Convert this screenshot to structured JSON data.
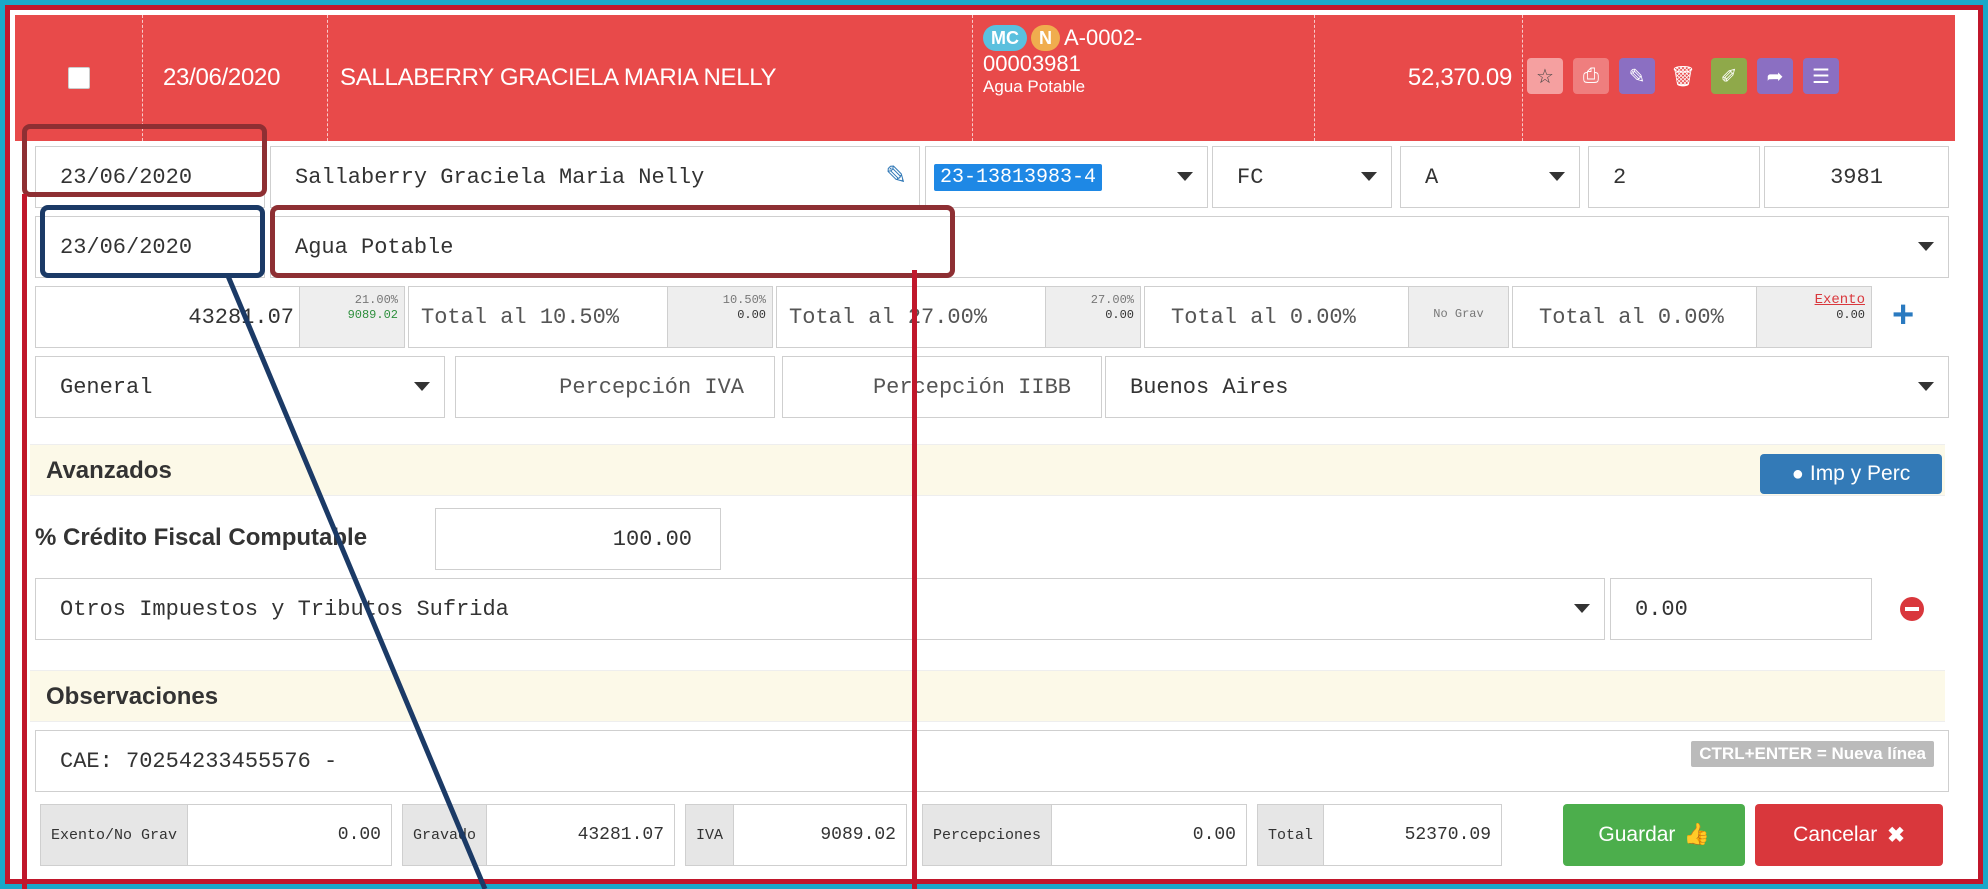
{
  "header": {
    "date": "23/06/2020",
    "name": "SALLABERRY GRACIELA MARIA NELLY",
    "badge1": "MC",
    "badge2": "N",
    "doc_line1": "A-0002-",
    "doc_line2": "00003981",
    "doc_desc": "Agua Potable",
    "amount": "52,370.09",
    "icons": [
      "star-icon",
      "print-icon",
      "pencil-icon",
      "trash-icon",
      "eraser-icon",
      "share-icon",
      "menu-icon"
    ]
  },
  "row1": {
    "date": "23/06/2020",
    "client": "Sallaberry Graciela Maria Nelly",
    "cuit": "23-13813983-4",
    "type": "FC",
    "letter": "A",
    "pos": "2",
    "number": "3981"
  },
  "row2": {
    "date": "23/06/2020",
    "concept": "Agua Potable"
  },
  "row3": {
    "neto": "43281.07",
    "rate1_top": "21.00%",
    "rate1_val": "9089.02",
    "total2_ph": "Total al 10.50%",
    "rate2_top": "10.50%",
    "rate2_val": "0.00",
    "total3_ph": "Total al 27.00%",
    "rate3_top": "27.00%",
    "rate3_val": "0.00",
    "total4_ph": "Total al 0.00%",
    "rate4_label": "No Grav",
    "total5_ph": "Total al 0.00%",
    "rate5_top": "Exento",
    "rate5_val": "0.00",
    "plus": "+"
  },
  "row4": {
    "category": "General",
    "perc_iva": "Percepción IVA",
    "perc_iibb": "Percepción IIBB",
    "province": "Buenos Aires"
  },
  "avanzados": {
    "title": "Avanzados",
    "button": "Imp y Perc",
    "credit_label": "% Crédito Fiscal Computable",
    "credit_value": "100.00",
    "tax_select": "Otros Impuestos y Tributos Sufrida",
    "tax_value": "0.00"
  },
  "observaciones": {
    "title": "Observaciones",
    "text": "CAE: 70254233455576 -",
    "hint": "CTRL+ENTER = Nueva línea"
  },
  "footer": {
    "exento_label": "Exento/No Grav",
    "exento_value": "0.00",
    "gravado_label": "Gravado",
    "gravado_value": "43281.07",
    "iva_label": "IVA",
    "iva_value": "9089.02",
    "perc_label": "Percepciones",
    "perc_value": "0.00",
    "total_label": "Total",
    "total_value": "52370.09",
    "save": "Guardar",
    "cancel": "Cancelar"
  },
  "colors": {
    "header_red": "#e84a4a",
    "annotation_red": "#8e2f33",
    "annotation_navy": "#1b3a66",
    "save_green": "#4cae4c",
    "cancel_red": "#d9373c"
  }
}
